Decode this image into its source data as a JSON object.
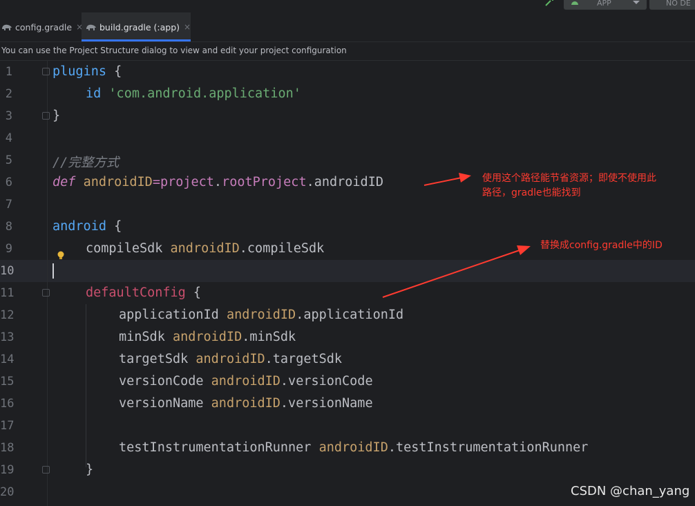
{
  "toolbar": {
    "run_config_label": "APP",
    "device_label": "NO DE",
    "icons": [
      "hammer-icon",
      "android-icon",
      "chevron-down-icon"
    ]
  },
  "tabs": [
    {
      "label": "config.gradle",
      "close": "×",
      "active": false
    },
    {
      "label": "build.gradle (:app)",
      "close": "×",
      "active": true
    }
  ],
  "banner": {
    "text": "You can use the Project Structure dialog to view and edit your project configuration"
  },
  "editor": {
    "line_numbers": [
      "1",
      "2",
      "3",
      "4",
      "5",
      "6",
      "7",
      "8",
      "9",
      "10",
      "11",
      "12",
      "13",
      "14",
      "15",
      "16",
      "17",
      "18",
      "19",
      "20"
    ],
    "active_line": "10",
    "lines": {
      "l1_kw": "plugins",
      "l1_brace": " {",
      "l2_id": "id",
      "l2_str": "'com.android.application'",
      "l3": "}",
      "l5_comment": "//完整方式",
      "l6_def": "def",
      "l6_var": "androidID",
      "l6_eq": "=",
      "l6_project": "project",
      "l6_dot1": ".",
      "l6_root": "rootProject",
      "l6_rest": ".androidID",
      "l8_kw": "android",
      "l8_brace": " {",
      "l9_key": "compileSdk",
      "l9_ref": "androidID",
      "l9_rest": ".compileSdk",
      "l11_kw": "defaultConfig",
      "l11_brace": " {",
      "l12_key": "applicationId",
      "l12_ref": "androidID",
      "l12_rest": ".applicationId",
      "l13_key": "minSdk",
      "l13_ref": "androidID",
      "l13_rest": ".minSdk",
      "l14_key": "targetSdk",
      "l14_ref": "androidID",
      "l14_rest": ".targetSdk",
      "l15_key": "versionCode",
      "l15_ref": "androidID",
      "l15_rest": ".versionCode",
      "l16_key": "versionName",
      "l16_ref": "androidID",
      "l16_rest": ".versionName",
      "l18_key": "testInstrumentationRunner",
      "l18_ref": "androidID",
      "l18_rest": ".testInstrumentationRunner",
      "l19": "}"
    }
  },
  "annotations": {
    "note1_line1": "使用这个路径能节省资源；即使不使用此",
    "note1_line2": "路径，gradle也能找到",
    "note2": "替换成config.gradle中的ID",
    "color": "#ff3b30"
  },
  "watermark": "CSDN @chan_yang"
}
